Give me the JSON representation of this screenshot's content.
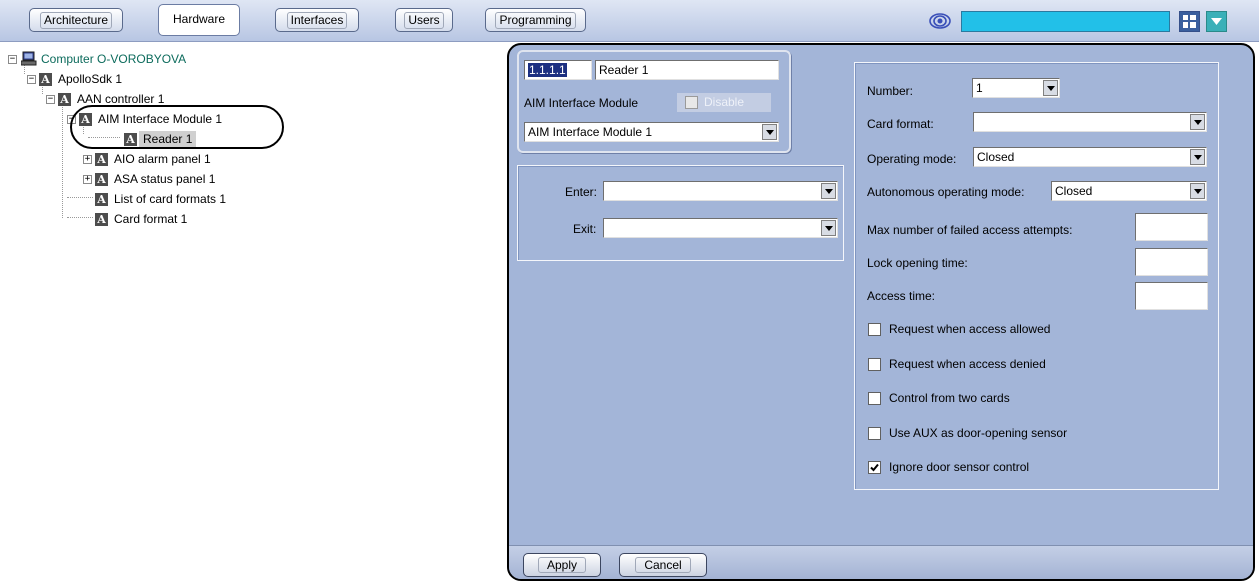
{
  "tabs": [
    {
      "label": "Architecture",
      "active": false
    },
    {
      "label": "Hardware",
      "active": true
    },
    {
      "label": "Interfaces",
      "active": false
    },
    {
      "label": "Users",
      "active": false
    },
    {
      "label": "Programming",
      "active": false
    }
  ],
  "topbar": {
    "status_color": "#22c0e8",
    "icons": [
      "eye-icon",
      "layout-grid-icon",
      "menu-down-icon"
    ]
  },
  "tree": {
    "root": "Computer O-VOROBYOVA",
    "items": [
      "ApolloSdk 1",
      "AAN controller 1",
      "AIM Interface Module 1",
      "Reader 1",
      "AIO alarm panel 1",
      "ASA status panel 1",
      "List of card formats 1",
      "Card format 1"
    ]
  },
  "object": {
    "id": "1.1.1.1",
    "name": "Reader 1",
    "parent_label": "AIM Interface Module",
    "disable_label": "Disable",
    "parent_select": "AIM Interface Module 1"
  },
  "zones": {
    "enter_label": "Enter:",
    "enter_value": "",
    "exit_label": "Exit:",
    "exit_value": ""
  },
  "settings": {
    "number_label": "Number:",
    "number_value": "1",
    "card_format_label": "Card format:",
    "card_format_value": "",
    "operating_mode_label": "Operating mode:",
    "operating_mode_value": "Closed",
    "autonomous_mode_label": "Autonomous operating mode:",
    "autonomous_mode_value": "Closed",
    "max_failed_label": "Max number of failed access attempts:",
    "max_failed_value": "",
    "lock_time_label": "Lock opening time:",
    "lock_time_value": "",
    "access_time_label": "Access time:",
    "access_time_value": "",
    "checkboxes": [
      {
        "label": "Request when access allowed",
        "checked": false
      },
      {
        "label": "Request when access denied",
        "checked": false
      },
      {
        "label": "Control from two cards",
        "checked": false
      },
      {
        "label": "Use AUX as door-opening sensor",
        "checked": false
      },
      {
        "label": "Ignore door sensor control",
        "checked": true
      }
    ]
  },
  "buttons": {
    "apply": "Apply",
    "cancel": "Cancel"
  },
  "colors": {
    "panel_bg": "#a3b5d8",
    "selected_id_bg": "#1c2f80",
    "root_text": "#0c6b5c"
  }
}
